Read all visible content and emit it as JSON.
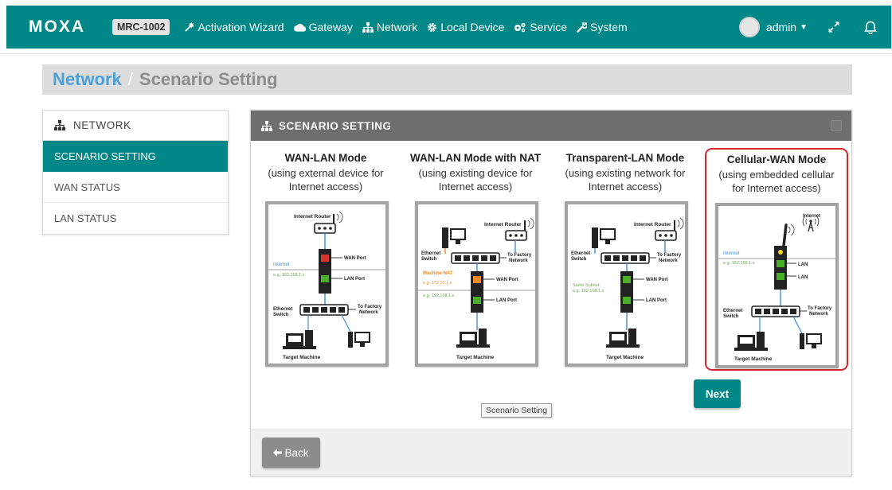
{
  "header": {
    "logo": "MOXA",
    "model": "MRC-1002",
    "nav": [
      {
        "label": "Activation Wizard",
        "icon": "magic-wand-icon"
      },
      {
        "label": "Gateway",
        "icon": "cloud-icon"
      },
      {
        "label": "Network",
        "icon": "sitemap-icon"
      },
      {
        "label": "Local Device",
        "icon": "gear-icon"
      },
      {
        "label": "Service",
        "icon": "gears-icon"
      },
      {
        "label": "System",
        "icon": "wrench-icon"
      }
    ],
    "user": "admin"
  },
  "breadcrumb": {
    "root": "Network",
    "separator": "/",
    "current": "Scenario Setting"
  },
  "sidebar": {
    "title": "NETWORK",
    "items": [
      {
        "label": "SCENARIO SETTING",
        "active": true
      },
      {
        "label": "WAN STATUS",
        "active": false
      },
      {
        "label": "LAN STATUS",
        "active": false
      }
    ]
  },
  "panel": {
    "title": "SCENARIO SETTING",
    "modes": [
      {
        "title": "WAN-LAN Mode",
        "desc_line1": "(using external device for",
        "desc_line2": "Internet access)",
        "diagram": {
          "router": "Internet Router",
          "wan_port": "WAN Port",
          "lan_port": "LAN Port",
          "net_label": "Internet",
          "net_example": "e.g. 192.168.1.x",
          "switch": [
            "Ethernet",
            "Switch"
          ],
          "factory": [
            "To Factory",
            "Network"
          ],
          "target": "Target Machine"
        }
      },
      {
        "title": "WAN-LAN Mode with NAT",
        "desc_line1": "(using existing device for",
        "desc_line2": "Internet access)",
        "diagram": {
          "router": "Internet Router",
          "switch": [
            "Ethernet",
            "Switch"
          ],
          "factory": [
            "To Factory",
            "Network"
          ],
          "nat_label": "Machine NAT",
          "nat_example": "e.g. 172.20.1.x",
          "net_example": "e.g. 192.168.1.x",
          "wan_port": "WAN Port",
          "lan_port": "LAN Port",
          "target": "Target Machine"
        }
      },
      {
        "title": "Transparent-LAN Mode",
        "desc_line1": "(using existing network for",
        "desc_line2": "Internet access)",
        "diagram": {
          "router": "Internet Router",
          "switch": [
            "Ethernet",
            "Switch"
          ],
          "factory": [
            "To Factory",
            "Network"
          ],
          "subnet_label": "Same Subnet:",
          "subnet_example": "e.g. 192.168.1.x",
          "wan_port": "WAN Port",
          "lan_port": "LAN Port",
          "target": "Target Machine"
        }
      },
      {
        "title": "Cellular-WAN Mode",
        "desc_line1": "(using embedded cellular",
        "desc_line2": "for Internet access)",
        "selected": true,
        "diagram": {
          "internet": "Internet",
          "net_label": "Internet",
          "net_example": "e.g. 192.168.1.x",
          "lan1": "LAN",
          "lan2": "LAN",
          "switch": [
            "Ethernet",
            "Switch"
          ],
          "factory": [
            "To Factory",
            "Network"
          ],
          "target": "Target Machine"
        }
      }
    ],
    "next_label": "Next",
    "tooltip": "Scenario Setting",
    "back_label": "Back"
  },
  "colors": {
    "brand": "#008787",
    "breadcrumb_link": "#4a9fd8",
    "panel_header": "#6e6e6e",
    "selected_outline": "#d8252b",
    "wan_indicator": "#d9342b",
    "lan_indicator": "#4caf2a",
    "nat_indicator": "#f08a24"
  }
}
